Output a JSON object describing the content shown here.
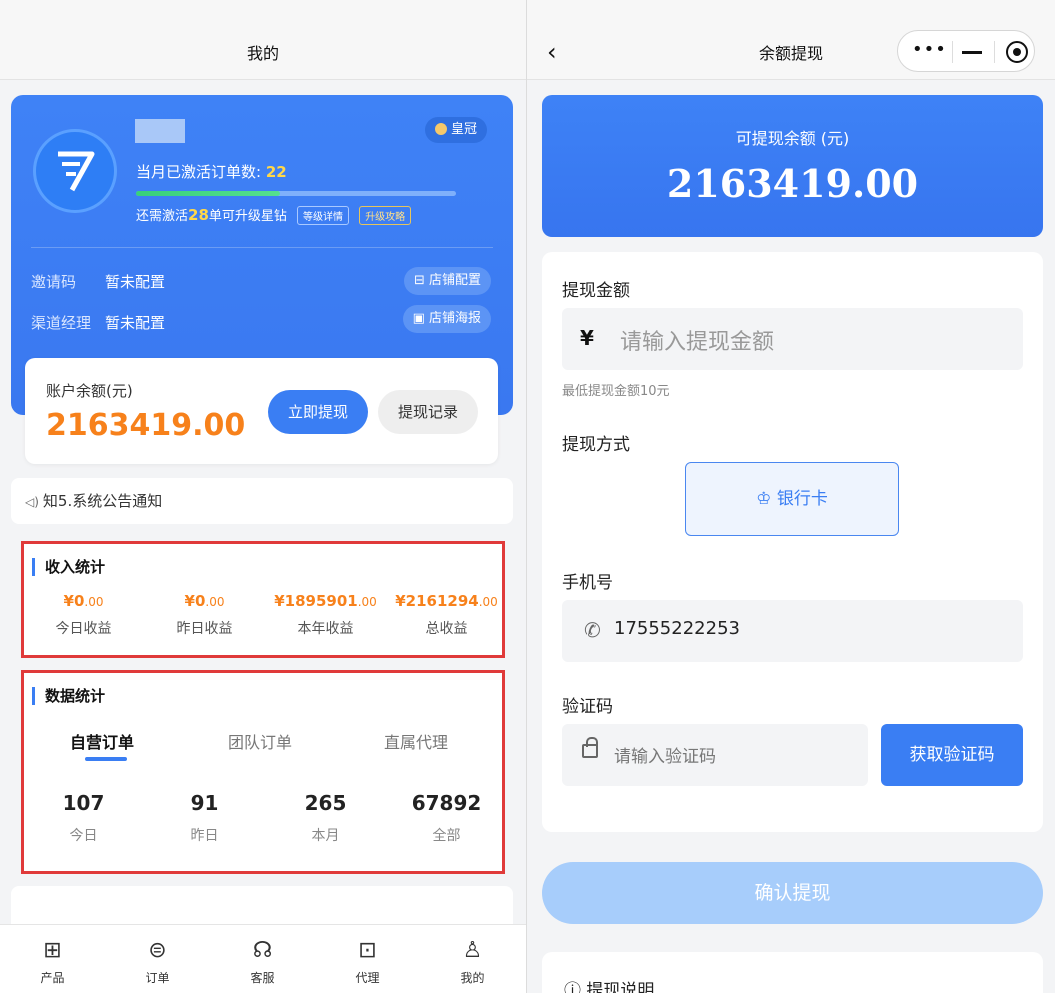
{
  "left": {
    "nav_title": "我的",
    "profile": {
      "crown_label": "皇冠",
      "activated_label": "当月已激活订单数: ",
      "activated_count": "22",
      "progress": 0.45,
      "upgrade_prefix": "还需激活",
      "upgrade_count": "28",
      "upgrade_suffix": "单可升级星钻",
      "tag_level_detail": "等级详情",
      "tag_upgrade_guide": "升级攻略",
      "invite_label": "邀请码",
      "invite_value": "暂未配置",
      "channel_label": "渠道经理",
      "channel_value": "暂未配置",
      "shop_config": "店铺配置",
      "shop_poster": "店铺海报"
    },
    "balance": {
      "label": "账户余额(元)",
      "value": "2163419.00",
      "withdraw_btn": "立即提现",
      "record_btn": "提现记录"
    },
    "notice": "知5.系统公告通知",
    "income": {
      "title": "收入统计",
      "items": [
        {
          "int": "¥0",
          "dec": ".00",
          "label": "今日收益"
        },
        {
          "int": "¥0",
          "dec": ".00",
          "label": "昨日收益"
        },
        {
          "int": "¥1895901",
          "dec": ".00",
          "label": "本年收益"
        },
        {
          "int": "¥2161294",
          "dec": ".00",
          "label": "总收益"
        }
      ]
    },
    "data_stats": {
      "title": "数据统计",
      "tabs": [
        "自营订单",
        "团队订单",
        "直属代理"
      ],
      "items": [
        {
          "value": "107",
          "label": "今日"
        },
        {
          "value": "91",
          "label": "昨日"
        },
        {
          "value": "265",
          "label": "本月"
        },
        {
          "value": "67892",
          "label": "全部"
        }
      ]
    },
    "tabbar": [
      {
        "label": "产品",
        "icon": "grid-icon"
      },
      {
        "label": "订单",
        "icon": "orders-icon"
      },
      {
        "label": "客服",
        "icon": "headset-icon"
      },
      {
        "label": "代理",
        "icon": "agent-icon"
      },
      {
        "label": "我的",
        "icon": "user-icon"
      }
    ]
  },
  "right": {
    "nav_title": "余额提现",
    "available_label": "可提现余额 (元)",
    "available_value": "2163419.00",
    "amount_label": "提现金额",
    "amount_currency": "¥",
    "amount_placeholder": "请输入提现金额",
    "min_hint": "最低提现金额10元",
    "method_label": "提现方式",
    "method_bank": "银行卡",
    "phone_label": "手机号",
    "phone_value": "17555222253",
    "code_label": "验证码",
    "code_placeholder": "请输入验证码",
    "code_btn": "获取验证码",
    "confirm_btn": "确认提现",
    "explain_title": "提现说明"
  },
  "colors": {
    "primary": "#3a7ef3",
    "orange": "#f7811b",
    "highlight_border": "#e03a3a"
  }
}
